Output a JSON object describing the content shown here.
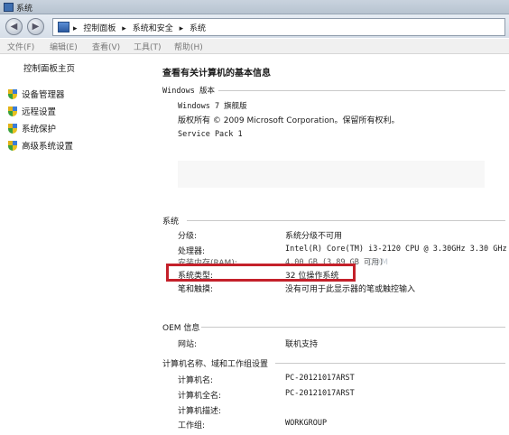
{
  "window": {
    "title": "系统"
  },
  "address": {
    "crumbs": [
      "控制面板",
      "系统和安全",
      "系统"
    ]
  },
  "menu": [
    "文件(F)",
    "编辑(E)",
    "查看(V)",
    "工具(T)",
    "帮助(H)"
  ],
  "sidebar": {
    "home": "控制面板主页",
    "tasks": [
      {
        "label": "设备管理器"
      },
      {
        "label": "远程设置"
      },
      {
        "label": "系统保护"
      },
      {
        "label": "高级系统设置"
      }
    ]
  },
  "main": {
    "heading": "查看有关计算机的基本信息",
    "edition": {
      "group": "Windows 版本",
      "name": "Windows 7 旗舰版",
      "copyright": "版权所有 © 2009 Microsoft Corporation。保留所有权利。",
      "sp": "Service Pack 1"
    },
    "system": {
      "group": "系统",
      "rows": [
        {
          "label": "分级:",
          "value": "系统分级不可用"
        },
        {
          "label": "处理器:",
          "value": "Intel(R) Core(TM) i3-2120 CPU @ 3.30GHz   3.30 GHz"
        },
        {
          "label": "安装内存(RAM):",
          "value": "4.00 GB (3.89 GB 可用)"
        },
        {
          "label": "系统类型:",
          "value": "32 位操作系统"
        },
        {
          "label": "笔和触摸:",
          "value": "没有可用于此显示器的笔或触控输入"
        }
      ],
      "watermark": ".COM"
    },
    "oem": {
      "group": "OEM 信息",
      "rows": [
        {
          "label": "网站:",
          "value": "联机支持"
        }
      ]
    },
    "computer": {
      "group": "计算机名称、域和工作组设置",
      "rows": [
        {
          "label": "计算机名:",
          "value": "PC-20121017ARST"
        },
        {
          "label": "计算机全名:",
          "value": "PC-20121017ARST"
        },
        {
          "label": "计算机描述:",
          "value": ""
        },
        {
          "label": "工作组:",
          "value": "WORKGROUP"
        }
      ]
    }
  },
  "colors": {
    "highlight": "#c4202a"
  }
}
